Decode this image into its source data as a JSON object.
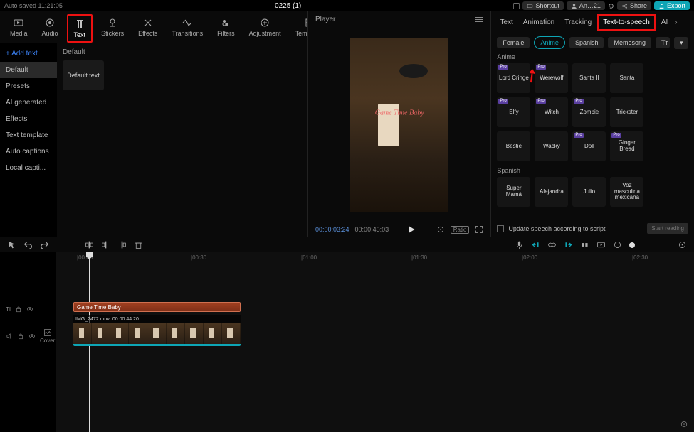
{
  "topbar": {
    "autosave": "Auto saved  11:21:05",
    "title": "0225 (1)",
    "shortcut": "Shortcut",
    "account": "An…21",
    "share": "Share",
    "export": "Export"
  },
  "library": {
    "tabs": [
      "Media",
      "Audio",
      "Text",
      "Stickers",
      "Effects",
      "Transitions",
      "Filters",
      "Adjustment",
      "Templates"
    ],
    "active_tab": 2,
    "side": {
      "add": "Add text",
      "items": [
        "Default",
        "Presets",
        "AI generated",
        "Effects",
        "Text template",
        "Auto captions",
        "Local capti..."
      ],
      "selected": 0
    },
    "heading": "Default",
    "thumb": "Default text"
  },
  "player": {
    "title": "Player",
    "overlay_text": "Game Time Baby",
    "current": "00:00:03:24",
    "duration": "00:00:45:03",
    "ratio": "Ratio"
  },
  "inspector": {
    "tabs": [
      "Text",
      "Animation",
      "Tracking",
      "Text-to-speech",
      "AI"
    ],
    "active_tab": 3,
    "filters": [
      "Female",
      "Anime",
      "Spanish",
      "Memesong"
    ],
    "active_filter": 1,
    "sections": [
      {
        "title": "Anime",
        "voices": [
          {
            "n": "Lord Cringe",
            "p": true
          },
          {
            "n": "Werewolf",
            "p": true
          },
          {
            "n": "Santa II",
            "p": false
          },
          {
            "n": "Santa",
            "p": false
          },
          {
            "n": "Elfy",
            "p": true
          },
          {
            "n": "Witch",
            "p": true
          },
          {
            "n": "Zombie",
            "p": true
          },
          {
            "n": "Trickster",
            "p": false
          },
          {
            "n": "Bestie",
            "p": false
          },
          {
            "n": "Wacky",
            "p": false
          },
          {
            "n": "Doll",
            "p": true
          },
          {
            "n": "Ginger Bread",
            "p": true
          }
        ]
      },
      {
        "title": "Spanish",
        "voices": [
          {
            "n": "Super Mamá",
            "p": false
          },
          {
            "n": "Alejandra",
            "p": false
          },
          {
            "n": "Julio",
            "p": false
          },
          {
            "n": "Voz masculina mexicana",
            "p": false
          }
        ]
      }
    ],
    "update_label": "Update speech according to script",
    "start_btn": "Start reading"
  },
  "timeline": {
    "marks": [
      "|00.00",
      "|00:30",
      "|01:00",
      "|01:30",
      "|02:00",
      "|02:30"
    ],
    "text_clip": "Game Time Baby",
    "video_name": "IMG_2472.mov",
    "video_dur": "00:00:44:20",
    "cover": "Cover"
  }
}
